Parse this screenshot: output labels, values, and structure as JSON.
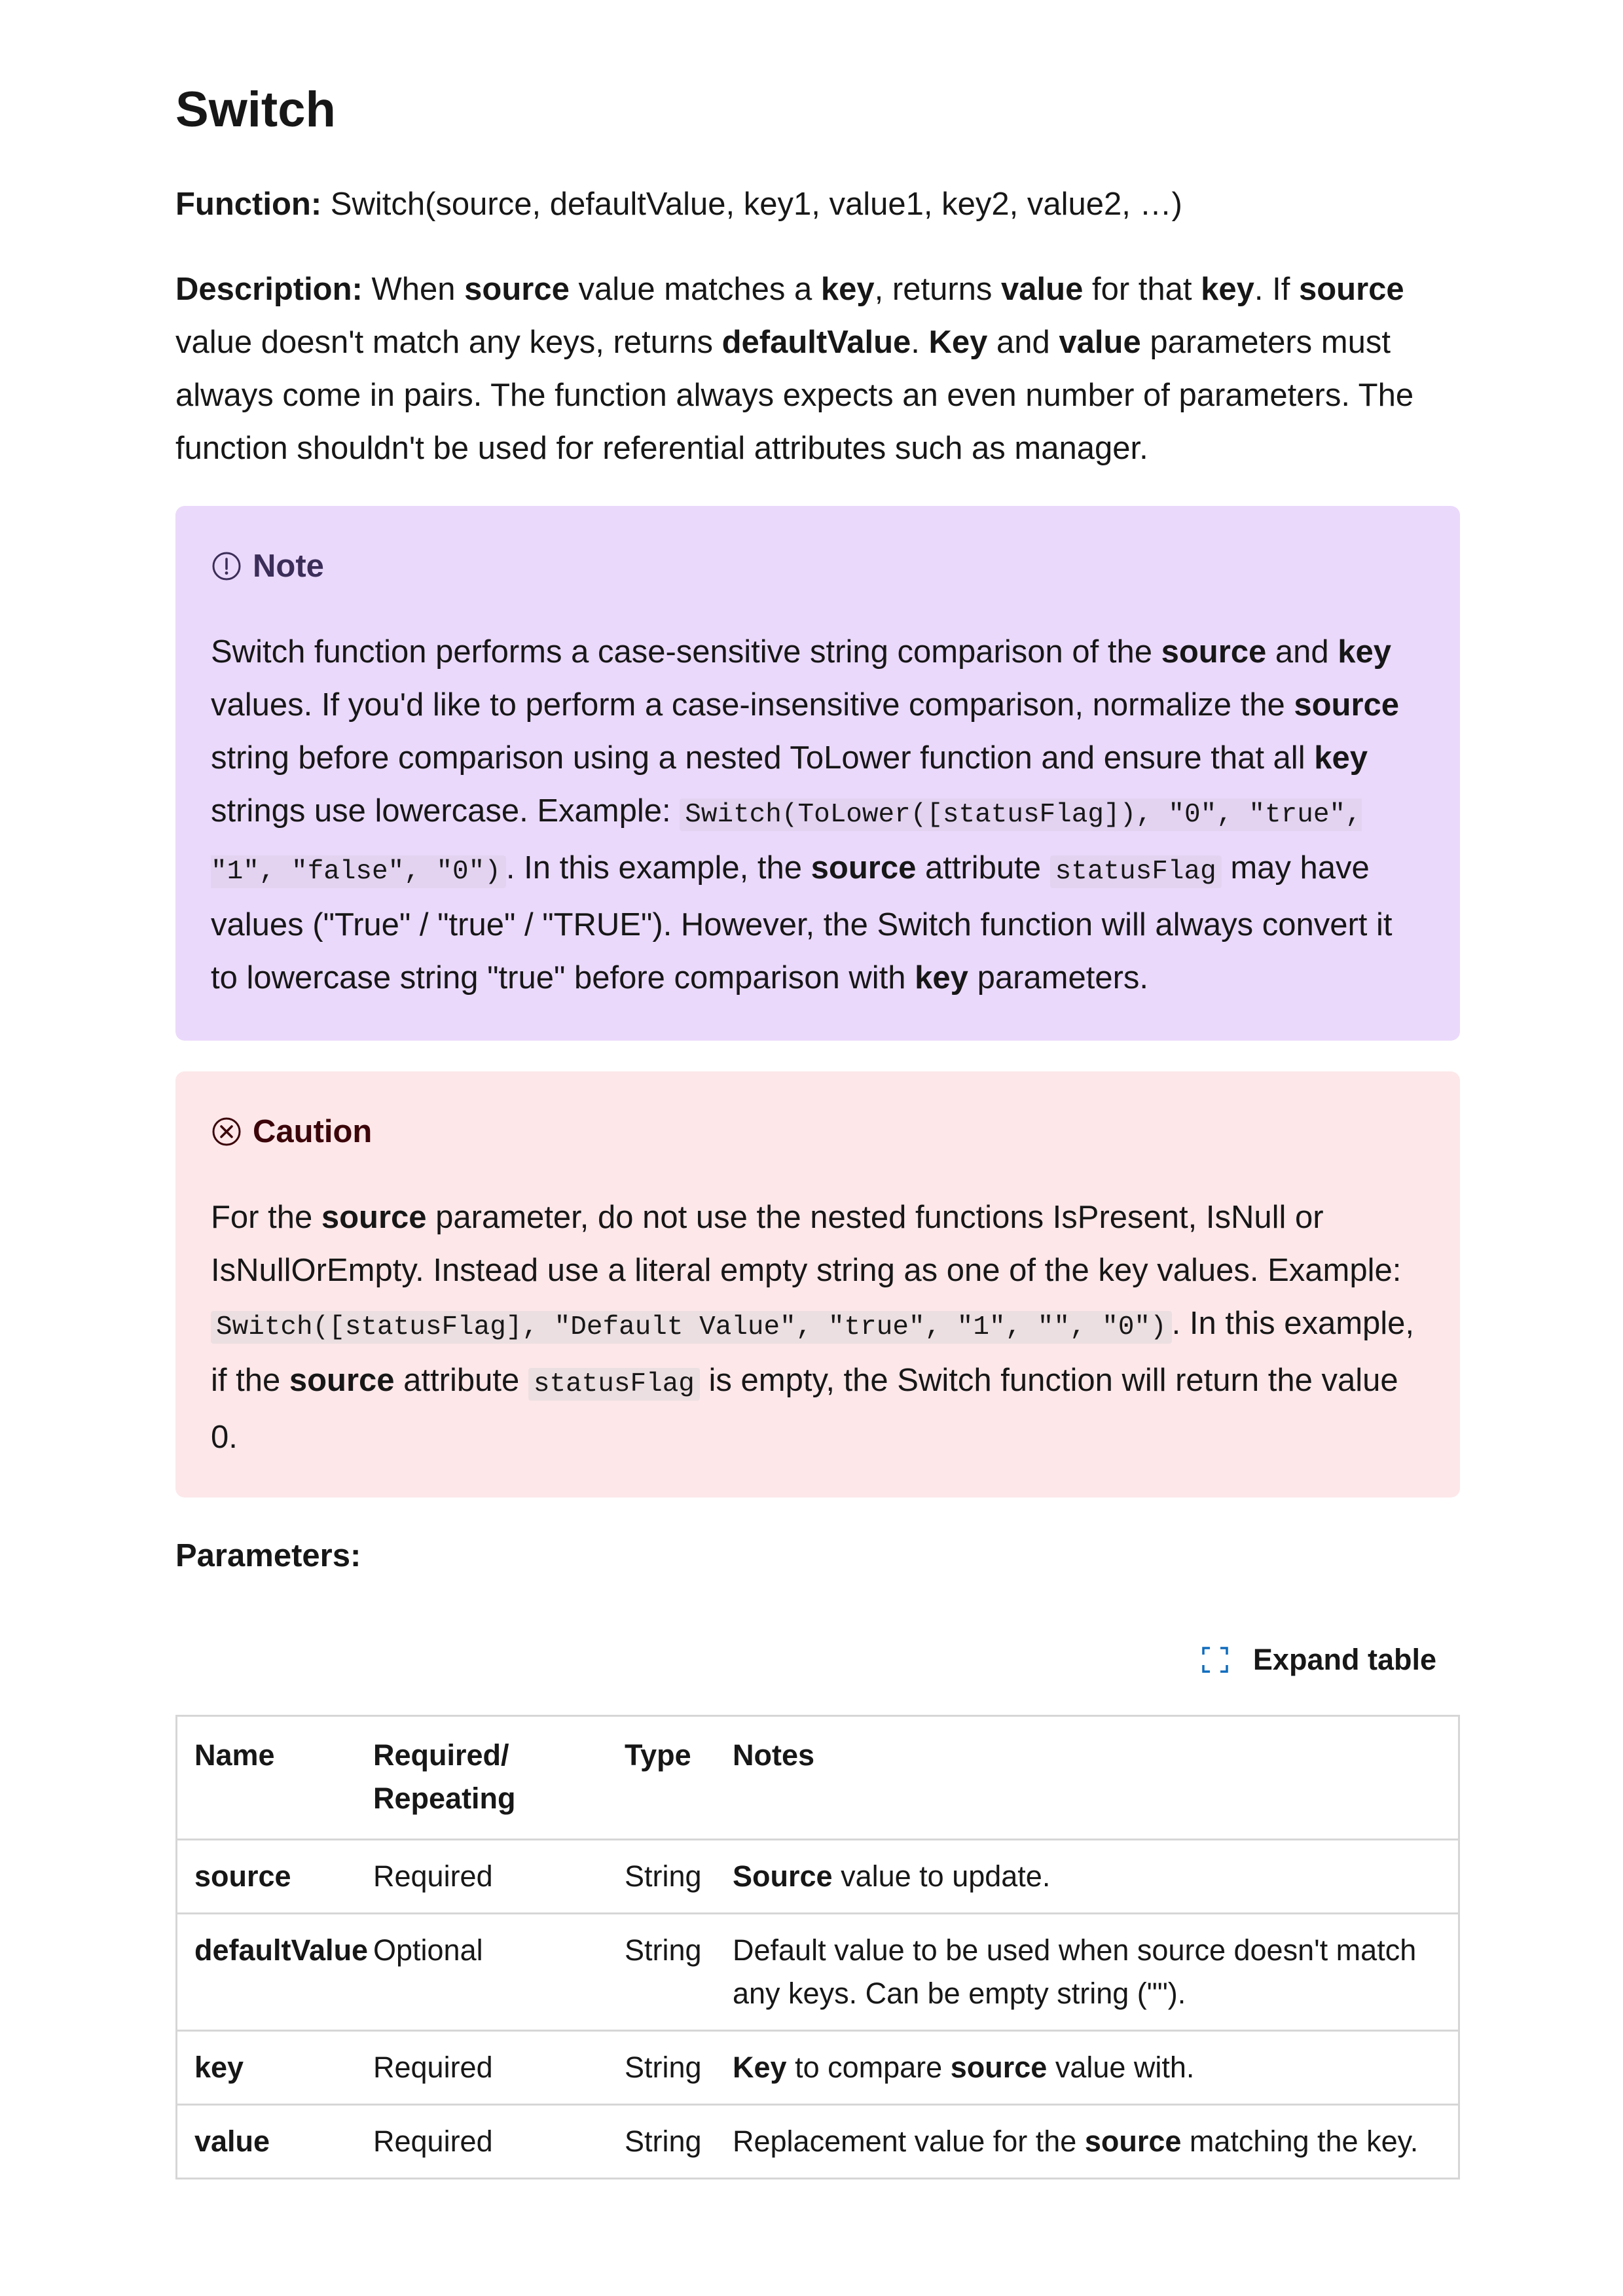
{
  "title": "Switch",
  "function": {
    "label": "Function:",
    "signature": "Switch(source, defaultValue, key1, value1, key2, value2, …)"
  },
  "description": {
    "label": "Description:",
    "t1": "When",
    "b1": "source",
    "t2": "value matches a",
    "b2": "key",
    "t3": ", returns",
    "b3": "value",
    "t4": "for that",
    "b4": "key",
    "t5": ". If",
    "b5": "source",
    "t6": "value doesn't match any keys, returns",
    "b6": "defaultValue",
    "t7": ".",
    "b7": "Key",
    "t8": "and",
    "b8": "value",
    "t9": "parameters must always come in pairs. The function always expects an even number of parameters. The function shouldn't be used for referential attributes such as manager."
  },
  "note": {
    "heading": "Note",
    "t1": "Switch function performs a case-sensitive string comparison of the",
    "b1": "source",
    "t2": "and",
    "b2": "key",
    "t3": "values. If you'd like to perform a case-insensitive comparison, normalize the",
    "b3": "source",
    "t4": "string before comparison using a nested ToLower function and ensure that all",
    "b4": "key",
    "t5": "strings use lowercase. Example:",
    "code1": "Switch(ToLower([statusFlag]), \"0\", \"true\", \"1\", \"false\", \"0\")",
    "t6": ". In this example, the",
    "b5": "source",
    "t7": "attribute",
    "code2": "statusFlag",
    "t8": "may have values (\"True\" / \"true\" / \"TRUE\"). However, the Switch function will always convert it to lowercase string \"true\" before comparison with",
    "b6": "key",
    "t9": "parameters."
  },
  "caution": {
    "heading": "Caution",
    "t1": "For the",
    "b1": "source",
    "t2": "parameter, do not use the nested functions IsPresent, IsNull or IsNullOrEmpty. Instead use a literal empty string as one of the key values. Example:",
    "code1": "Switch([statusFlag], \"Default Value\", \"true\", \"1\", \"\", \"0\")",
    "t3": ". In this example, if the",
    "b2": "source",
    "t4": "attribute",
    "code2": "statusFlag",
    "t5": "is empty, the Switch function will return the value 0."
  },
  "parameters_label": "Parameters:",
  "expand_table": "Expand table",
  "table": {
    "headers": [
      "Name",
      "Required/ Repeating",
      "Type",
      "Notes"
    ],
    "rows": [
      {
        "name": "source",
        "required": "Required",
        "type": "String",
        "notes_b": "Source",
        "notes": "value to update."
      },
      {
        "name": "defaultValue",
        "required": "Optional",
        "type": "String",
        "notes": "Default value to be used when source doesn't match any keys. Can be empty string (\"\")."
      },
      {
        "name": "key",
        "required": "Required",
        "type": "String",
        "notes_b": "Key",
        "notes": "to compare",
        "notes_b2": "source",
        "notes2": "value with."
      },
      {
        "name": "value",
        "required": "Required",
        "type": "String",
        "notes": "Replacement value for the",
        "notes_b2": "source",
        "notes2": "matching the key."
      }
    ]
  }
}
